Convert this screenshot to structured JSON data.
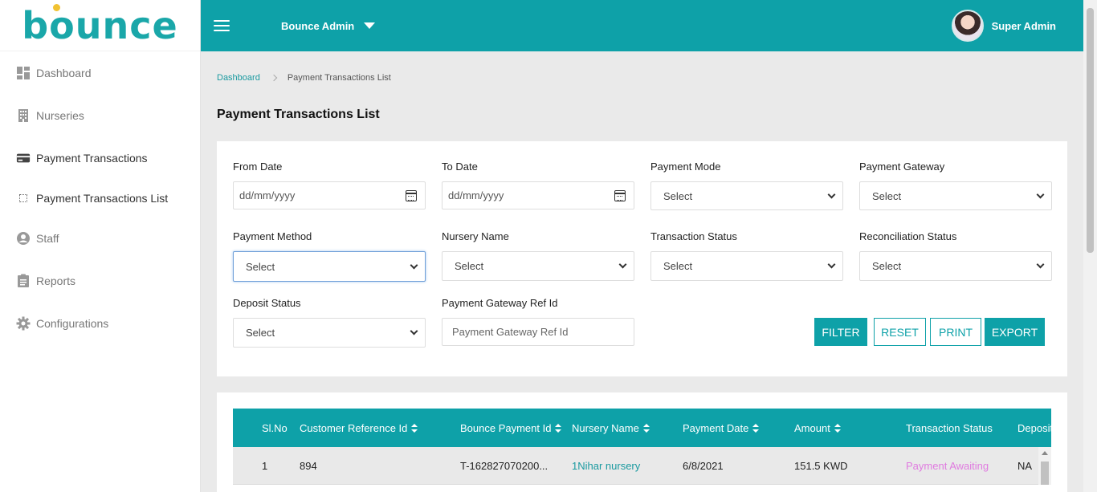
{
  "logo": {
    "text": "bounce"
  },
  "sidebar": {
    "items": [
      {
        "label": "Dashboard",
        "icon": "dashboard-icon"
      },
      {
        "label": "Nurseries",
        "icon": "building-icon"
      },
      {
        "label": "Payment Transactions",
        "icon": "credit-card-icon"
      },
      {
        "label": "Payment Transactions List",
        "icon": "dotted-square-icon"
      },
      {
        "label": "Staff",
        "icon": "user-circle-icon"
      },
      {
        "label": "Reports",
        "icon": "clipboard-icon"
      },
      {
        "label": "Configurations",
        "icon": "gear-icon"
      }
    ]
  },
  "header": {
    "brand": "Bounce Admin",
    "user": "Super Admin",
    "color": "#0ea1a8"
  },
  "breadcrumb": {
    "home": "Dashboard",
    "current": "Payment Transactions List"
  },
  "page": {
    "title": "Payment Transactions List"
  },
  "filters": {
    "from_date": {
      "label": "From Date",
      "placeholder": "dd/mm/yyyy"
    },
    "to_date": {
      "label": "To Date",
      "placeholder": "dd/mm/yyyy"
    },
    "payment_mode": {
      "label": "Payment Mode",
      "value": "Select"
    },
    "payment_gateway": {
      "label": "Payment Gateway",
      "value": "Select"
    },
    "payment_method": {
      "label": "Payment Method",
      "value": "Select"
    },
    "nursery_name": {
      "label": "Nursery Name",
      "value": "Select"
    },
    "transaction_status": {
      "label": "Transaction Status",
      "value": "Select"
    },
    "reconciliation_status": {
      "label": "Reconciliation Status",
      "value": "Select"
    },
    "deposit_status": {
      "label": "Deposit Status",
      "value": "Select"
    },
    "gateway_ref": {
      "label": "Payment Gateway Ref Id",
      "placeholder": "Payment Gateway Ref Id"
    }
  },
  "buttons": {
    "filter": "FILTER",
    "reset": "RESET",
    "print": "PRINT",
    "export": "EXPORT"
  },
  "table": {
    "columns": [
      "Sl.No",
      "Customer Reference Id",
      "Bounce Payment Id",
      "Nursery Name",
      "Payment Date",
      "Amount",
      "Transaction Status",
      "Deposit"
    ],
    "rows": [
      {
        "slno": "1",
        "customer_ref": "894",
        "bounce_id": "T-162827070200...",
        "nursery": "1Nihar nursery",
        "date": "6/8/2021",
        "amount": "151.5 KWD",
        "status": "Payment Awaiting",
        "deposit": "NA"
      }
    ]
  }
}
